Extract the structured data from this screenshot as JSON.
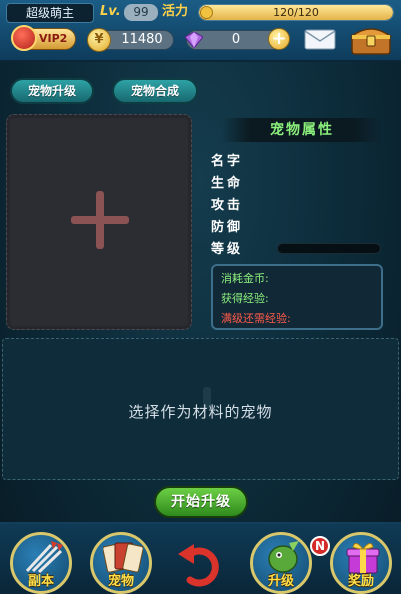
{
  "status_bar": {
    "player_name": "超级萌主",
    "level_label": "Lv.",
    "level_value": "99",
    "energy_label": "活力",
    "energy_text": "120/120",
    "energy_fraction": 1.0,
    "vip_label": "VIP2",
    "gold_symbol": "¥",
    "gold_value": "11480",
    "gem_value": "0",
    "plus_symbol": "+"
  },
  "tabs": [
    {
      "label": "宠物升级"
    },
    {
      "label": "宠物合成"
    }
  ],
  "attributes": {
    "title": "宠物属性",
    "labels": [
      "名字",
      "生命",
      "攻击",
      "防御",
      "等级"
    ]
  },
  "cost_panel": {
    "gold_cost": "消耗金币:",
    "exp_gain": "获得经验:",
    "exp_needed": "满级还需经验:"
  },
  "material": {
    "hint": "选择作为材料的宠物"
  },
  "start_button": {
    "label": "开始升级"
  },
  "bottom_nav": {
    "items": [
      {
        "label": "副本",
        "icon": "arrows-icon"
      },
      {
        "label": "宠物",
        "icon": "cards-icon"
      },
      {
        "label": "",
        "icon": "return-icon"
      },
      {
        "label": "升级",
        "icon": "dragon-icon"
      },
      {
        "label": "奖励",
        "icon": "gift-icon"
      }
    ],
    "badge": "N"
  },
  "colors": {
    "accent_green": "#8cf07c",
    "warning_red": "#ff5a4a",
    "gold": "#ffd24a"
  }
}
